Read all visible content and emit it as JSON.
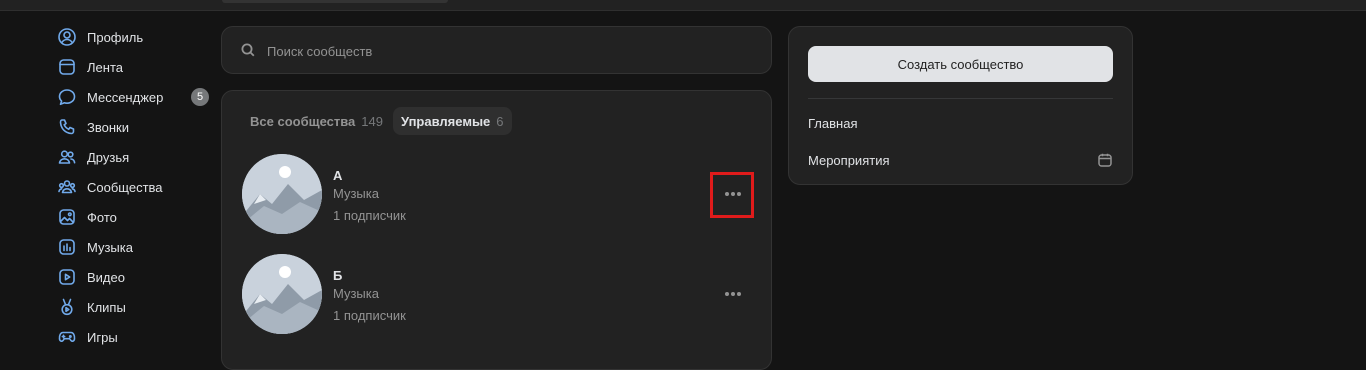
{
  "sidebar": {
    "items": [
      {
        "label": "Профиль",
        "icon": "profile-icon"
      },
      {
        "label": "Лента",
        "icon": "feed-icon"
      },
      {
        "label": "Мессенджер",
        "icon": "messenger-icon",
        "badge": "5"
      },
      {
        "label": "Звонки",
        "icon": "phone-icon"
      },
      {
        "label": "Друзья",
        "icon": "friends-icon"
      },
      {
        "label": "Сообщества",
        "icon": "communities-icon"
      },
      {
        "label": "Фото",
        "icon": "photo-icon"
      },
      {
        "label": "Музыка",
        "icon": "music-icon"
      },
      {
        "label": "Видео",
        "icon": "video-icon"
      },
      {
        "label": "Клипы",
        "icon": "clips-icon"
      },
      {
        "label": "Игры",
        "icon": "games-icon"
      }
    ]
  },
  "search": {
    "placeholder": "Поиск сообществ",
    "value": ""
  },
  "tabs": [
    {
      "label": "Все сообщества",
      "count": "149",
      "active": false
    },
    {
      "label": "Управляемые",
      "count": "6",
      "active": true
    }
  ],
  "communities": [
    {
      "name": "А",
      "category": "Музыка",
      "subscribers": "1 подписчик"
    },
    {
      "name": "Б",
      "category": "Музыка",
      "subscribers": "1 подписчик"
    }
  ],
  "side_panel": {
    "create_label": "Создать сообщество",
    "menu": [
      {
        "label": "Главная"
      },
      {
        "label": "Мероприятия",
        "icon": "calendar-icon"
      }
    ]
  },
  "colors": {
    "background": "#141414",
    "card": "#222222",
    "accent_icon": "#71aaeb",
    "highlight": "#e01b1b"
  }
}
